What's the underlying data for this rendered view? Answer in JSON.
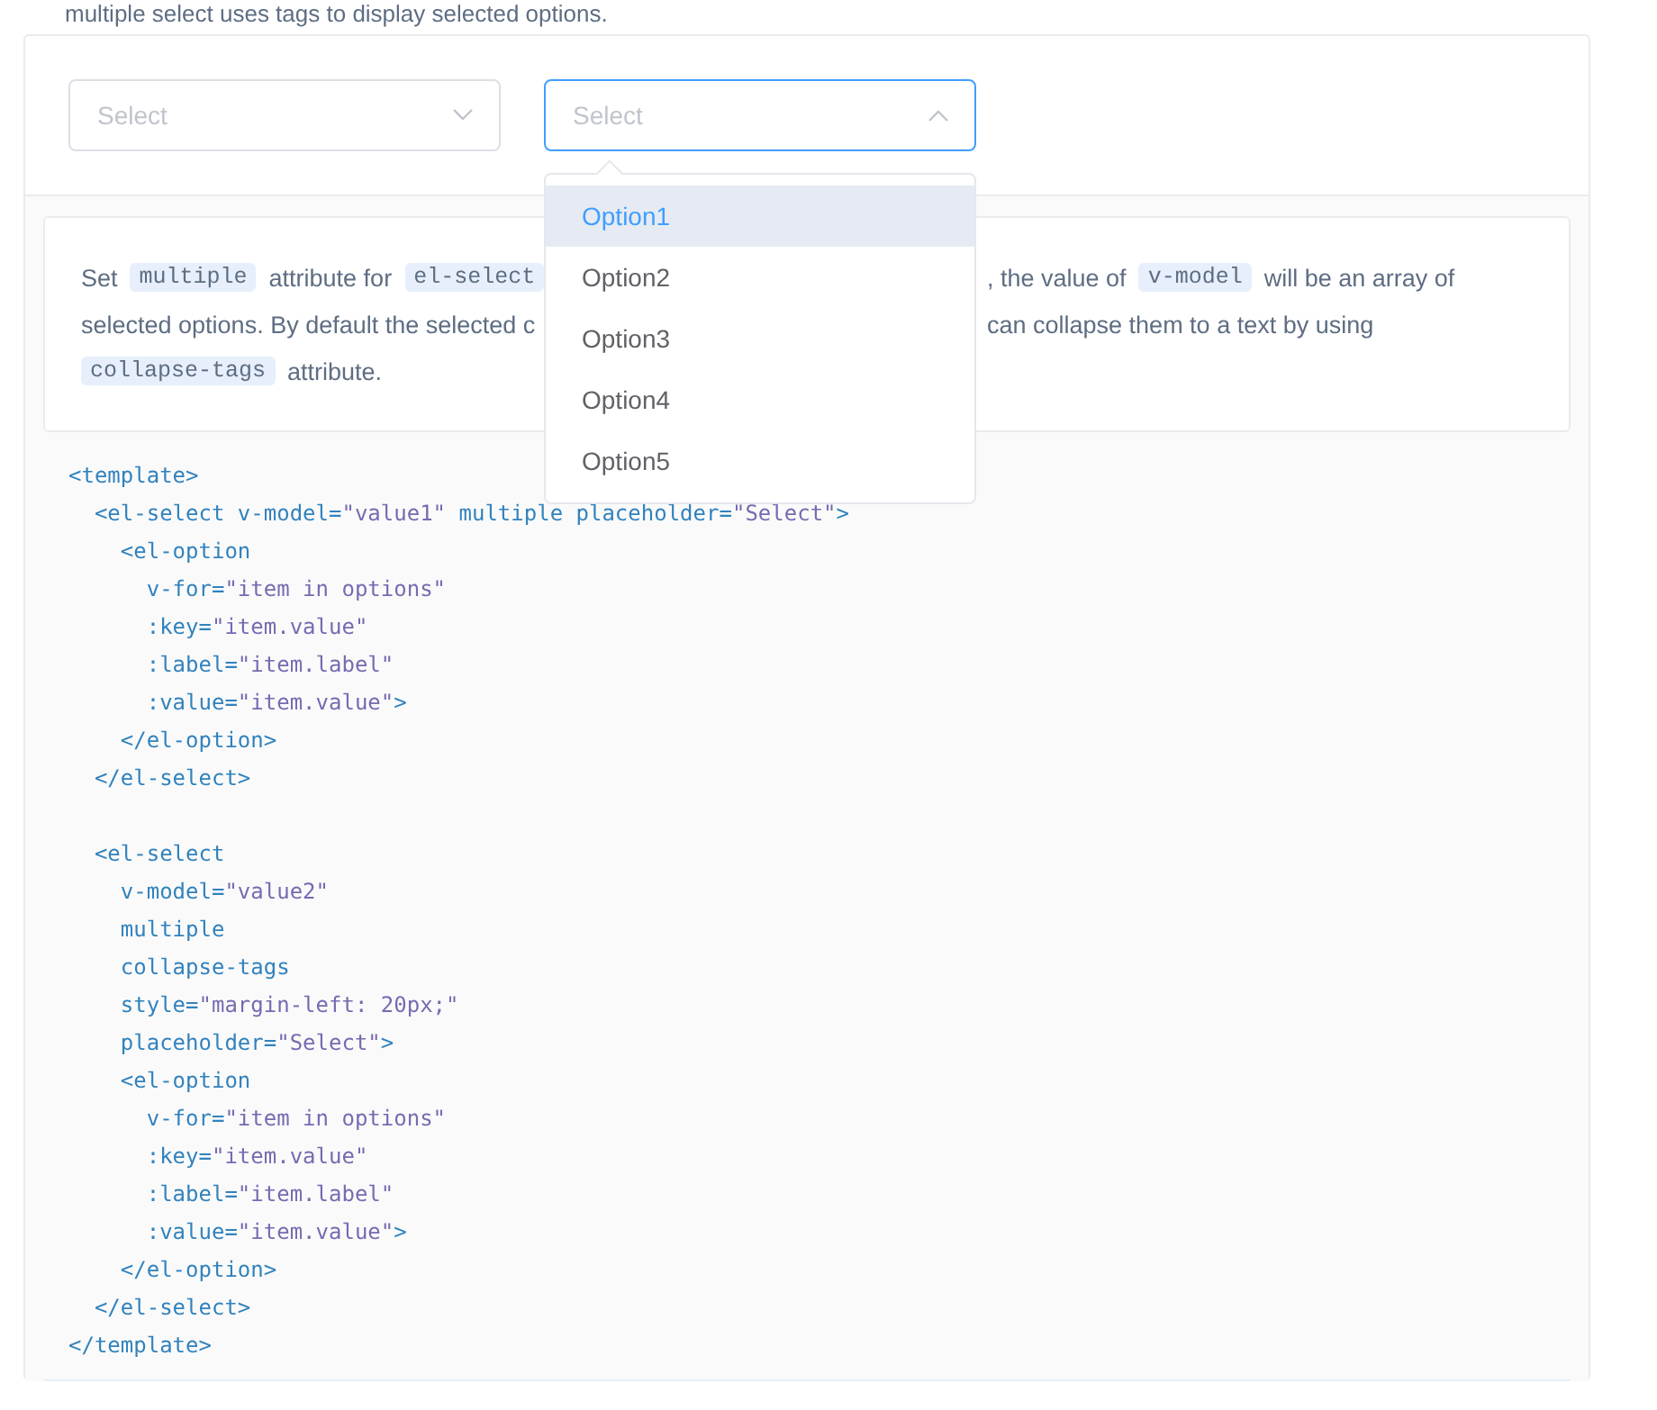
{
  "intro": "multiple select uses tags to display selected options.",
  "selects": [
    {
      "placeholder": "Select",
      "open": false
    },
    {
      "placeholder": "Select",
      "open": true,
      "options": [
        {
          "label": "Option1",
          "highlighted": true
        },
        {
          "label": "Option2",
          "highlighted": false
        },
        {
          "label": "Option3",
          "highlighted": false
        },
        {
          "label": "Option4",
          "highlighted": false
        },
        {
          "label": "Option5",
          "highlighted": false
        }
      ]
    }
  ],
  "description": {
    "left_lines": [
      [
        {
          "kind": "text",
          "text": "Set"
        },
        {
          "kind": "code",
          "text": "multiple"
        },
        {
          "kind": "text",
          "text": "attribute for"
        },
        {
          "kind": "code",
          "text": "el-select"
        }
      ],
      [
        {
          "kind": "text",
          "text": "selected options. By default the selected c"
        }
      ],
      [
        {
          "kind": "code",
          "text": "collapse-tags"
        },
        {
          "kind": "text",
          "text": "attribute."
        }
      ]
    ],
    "right_lines": [
      [
        {
          "kind": "text",
          "text": ", the value of"
        },
        {
          "kind": "code",
          "text": "v-model"
        },
        {
          "kind": "text",
          "text": "will be an array of"
        }
      ],
      [
        {
          "kind": "text",
          "text": "can collapse them to a text by using"
        }
      ]
    ]
  },
  "code_blocks": [
    [
      "<template>",
      "  <el-select v-model=\"value1\" multiple placeholder=\"Select\">",
      "    <el-option",
      "      v-for=\"item in options\"",
      "      :key=\"item.value\"",
      "      :label=\"item.label\"",
      "      :value=\"item.value\">",
      "    </el-option>",
      "  </el-select>"
    ],
    [
      "  <el-select",
      "    v-model=\"value2\"",
      "    multiple",
      "    collapse-tags",
      "    style=\"margin-left: 20px;\"",
      "    placeholder=\"Select\">",
      "    <el-option",
      "      v-for=\"item in options\"",
      "      :key=\"item.value\"",
      "      :label=\"item.label\"",
      "      :value=\"item.value\">",
      "    </el-option>",
      "  </el-select>",
      "</template>"
    ]
  ]
}
